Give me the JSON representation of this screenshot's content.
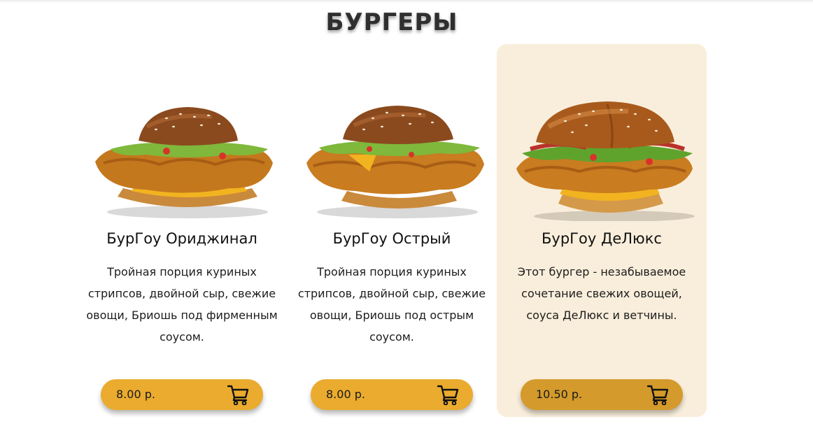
{
  "section": {
    "title": "БУРГЕРЫ"
  },
  "products": [
    {
      "name": "БурГоу Ориджинал",
      "description": "Тройная порция куриных стрипсов, двойной сыр, свежие овощи, Бриошь под фирменным соусом.",
      "price": "8.00 р.",
      "image_icon": "burger-photo",
      "highlighted": false
    },
    {
      "name": "БурГоу Острый",
      "description": "Тройная порция куриных стрипсов, двойной сыр, свежие овощи, Бриошь под острым соусом.",
      "price": "8.00 р.",
      "image_icon": "burger-photo",
      "highlighted": false
    },
    {
      "name": "БурГоу ДеЛюкс",
      "description": "Этот бургер - незабываемое сочетание свежих овощей, соуса ДеЛюкс и ветчины.",
      "price": "10.50 р.",
      "image_icon": "burger-photo",
      "highlighted": true
    }
  ],
  "colors": {
    "accent": "#eaab2e",
    "accent_active": "#d49a2b",
    "highlight_bg": "#f9eedb",
    "title": "#2f2f2f"
  },
  "icons": {
    "cart": "cart-icon"
  }
}
